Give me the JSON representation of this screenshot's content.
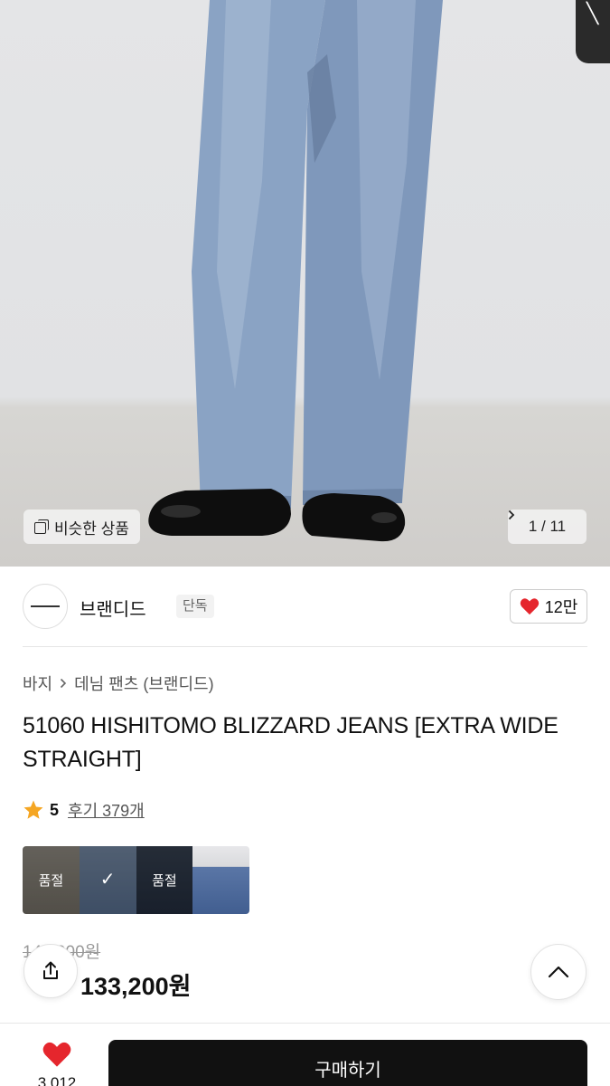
{
  "hero": {
    "similar_label": "비슷한 상품",
    "pager": "1 / 11"
  },
  "brand": {
    "name": "브랜디드",
    "tag": "단독",
    "likes": "12만"
  },
  "breadcrumb": {
    "items": [
      "바지",
      "데님 팬츠 (브랜디드)"
    ]
  },
  "product": {
    "title": "51060 HISHITOMO BLIZZARD JEANS [EXTRA WIDE STRAIGHT]",
    "rating": "5",
    "reviews": "후기 379개"
  },
  "swatches": [
    {
      "label": "품절",
      "color": "#8a857c",
      "state": "soldout"
    },
    {
      "label": "",
      "color": "#6f87a6",
      "state": "selected"
    },
    {
      "label": "품절",
      "color": "#2e3a4e",
      "state": "soldout"
    },
    {
      "label": "",
      "color": "#5571a0",
      "state": "normal"
    }
  ],
  "price": {
    "original": "148,000원",
    "sale": "133,200원"
  },
  "bottom": {
    "fav_count": "3,012",
    "buy_label": "구매하기"
  },
  "colors": {
    "heart": "#e5262d",
    "buy_bg": "#111111",
    "star": "#f5a623"
  }
}
